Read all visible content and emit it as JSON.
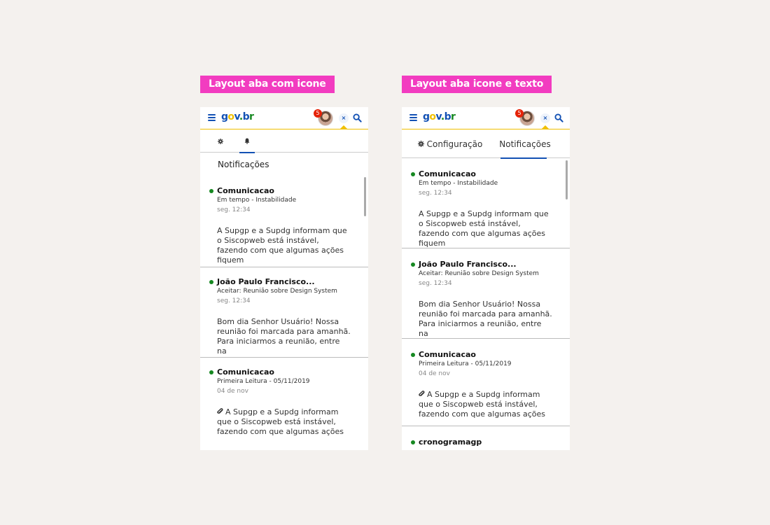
{
  "labels": {
    "left": "Layout aba com icone",
    "right": "Layout aba icone e texto"
  },
  "header": {
    "logo": "gov.br",
    "badge_count": "5",
    "close_label": "×"
  },
  "left_phone": {
    "section_title": "Notificações",
    "items": [
      {
        "title": "Comunicacao",
        "sub": "Em tempo - Instabilidade",
        "date": "seg. 12:34",
        "body": "A Supgp e a Supdg informam que o Siscopweb está instável, fazendo com que algumas ações fiquem"
      },
      {
        "title": "João Paulo Francisco...",
        "sub": "Aceitar: Reunião sobre Design System",
        "date": "seg. 12:34",
        "body": "Bom dia Senhor Usuário!  Nossa reunião foi marcada para amanhã. Para iniciarmos a reunião, entre na"
      },
      {
        "title": "Comunicacao",
        "sub": "Primeira Leitura - 05/11/2019",
        "date": "04 de nov",
        "body": "A Supgp e a Supdg informam que o Siscopweb está instável, fazendo com que algumas ações"
      }
    ]
  },
  "right_phone": {
    "tabs": [
      {
        "label": "Configuração",
        "icon": "gear-icon"
      },
      {
        "label": "Notificações",
        "icon": "bell-icon"
      }
    ],
    "items": [
      {
        "title": "Comunicacao",
        "sub": "Em tempo - Instabilidade",
        "date": "seg. 12:34",
        "body": "A Supgp e a Supdg informam que o Siscopweb está instável, fazendo com que algumas ações fiquem"
      },
      {
        "title": "João Paulo Francisco...",
        "sub": "Aceitar: Reunião sobre Design System",
        "date": "seg. 12:34",
        "body": "Bom dia Senhor Usuário!  Nossa reunião foi marcada para amanhã. Para iniciarmos a reunião, entre na"
      },
      {
        "title": "Comunicacao",
        "sub": "Primeira Leitura - 05/11/2019",
        "date": "04 de nov",
        "body": "A Supgp e a Supdg informam que o Siscopweb está instável, fazendo com que algumas ações"
      },
      {
        "title": "cronogramagp"
      }
    ]
  },
  "colors": {
    "tag": "#f23cc0",
    "primary": "#1351b4",
    "accent_yellow": "#f0c000",
    "unread_dot": "#168821",
    "badge": "#e52207"
  }
}
